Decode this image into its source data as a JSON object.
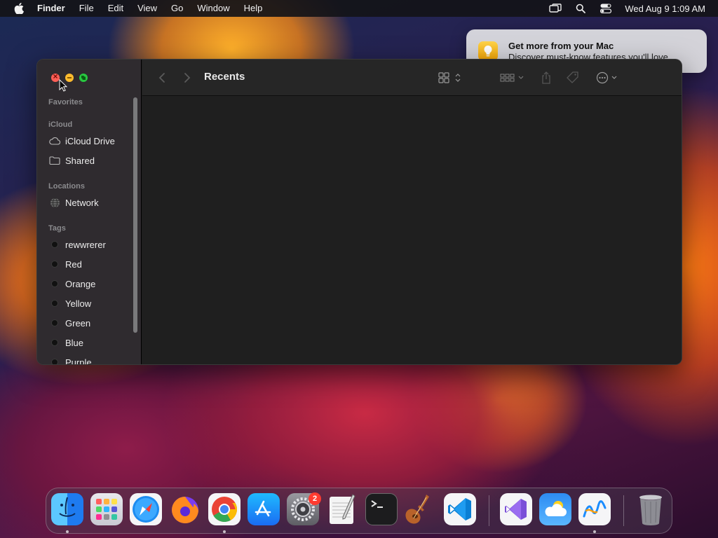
{
  "menubar": {
    "app_name": "Finder",
    "menus": [
      "File",
      "Edit",
      "View",
      "Go",
      "Window",
      "Help"
    ],
    "clock": "Wed Aug 9  1:09 AM",
    "status_icons": [
      "screen-mirroring-icon",
      "spotlight-search-icon",
      "control-center-icon"
    ]
  },
  "notification": {
    "title": "Get more from your Mac",
    "body": "Discover must-know features you'll love.",
    "icon": "tips-lightbulb-icon"
  },
  "finder": {
    "title": "Recents",
    "sidebar": {
      "favorites_label": "Favorites",
      "icloud_label": "iCloud",
      "icloud_items": [
        {
          "label": "iCloud Drive",
          "icon": "cloud-icon"
        },
        {
          "label": "Shared",
          "icon": "shared-folder-icon"
        }
      ],
      "locations_label": "Locations",
      "location_items": [
        {
          "label": "Network",
          "icon": "network-globe-icon"
        }
      ],
      "tags_label": "Tags",
      "tags": [
        "rewwrerer",
        "Red",
        "Orange",
        "Yellow",
        "Green",
        "Blue",
        "Purple"
      ]
    },
    "toolbar_icons": [
      "back-icon",
      "forward-icon",
      "view-mode-icon",
      "group-icon",
      "share-icon",
      "tag-icon",
      "more-actions-icon",
      "search-icon"
    ]
  },
  "dock": {
    "apps": [
      {
        "name": "Finder",
        "icon": "finder-icon",
        "running": true
      },
      {
        "name": "Launchpad",
        "icon": "launchpad-icon",
        "running": false
      },
      {
        "name": "Safari",
        "icon": "safari-icon",
        "running": false
      },
      {
        "name": "Firefox",
        "icon": "firefox-icon",
        "running": false
      },
      {
        "name": "Google Chrome",
        "icon": "chrome-icon",
        "running": true
      },
      {
        "name": "App Store",
        "icon": "app-store-icon",
        "running": false
      },
      {
        "name": "System Settings",
        "icon": "system-settings-icon",
        "running": false,
        "badge": "2"
      },
      {
        "name": "TextEdit",
        "icon": "textedit-icon",
        "running": false
      },
      {
        "name": "Terminal",
        "icon": "terminal-icon",
        "running": false
      },
      {
        "name": "GarageBand",
        "icon": "garageband-icon",
        "running": false
      },
      {
        "name": "Visual Studio Code",
        "icon": "vscode-icon",
        "running": false
      },
      {
        "name": "Visual Studio",
        "icon": "visual-studio-icon",
        "running": false
      },
      {
        "name": "Weather",
        "icon": "weather-icon",
        "running": false
      },
      {
        "name": "Freeform",
        "icon": "freeform-icon",
        "running": true
      },
      {
        "name": "Trash",
        "icon": "trash-icon",
        "running": false
      }
    ]
  },
  "colors": {
    "tag_dot": "#111111",
    "notification_bg": "#e1e1e4",
    "sidebar_bg": "#302c30",
    "window_bg": "#1f1f1f"
  }
}
